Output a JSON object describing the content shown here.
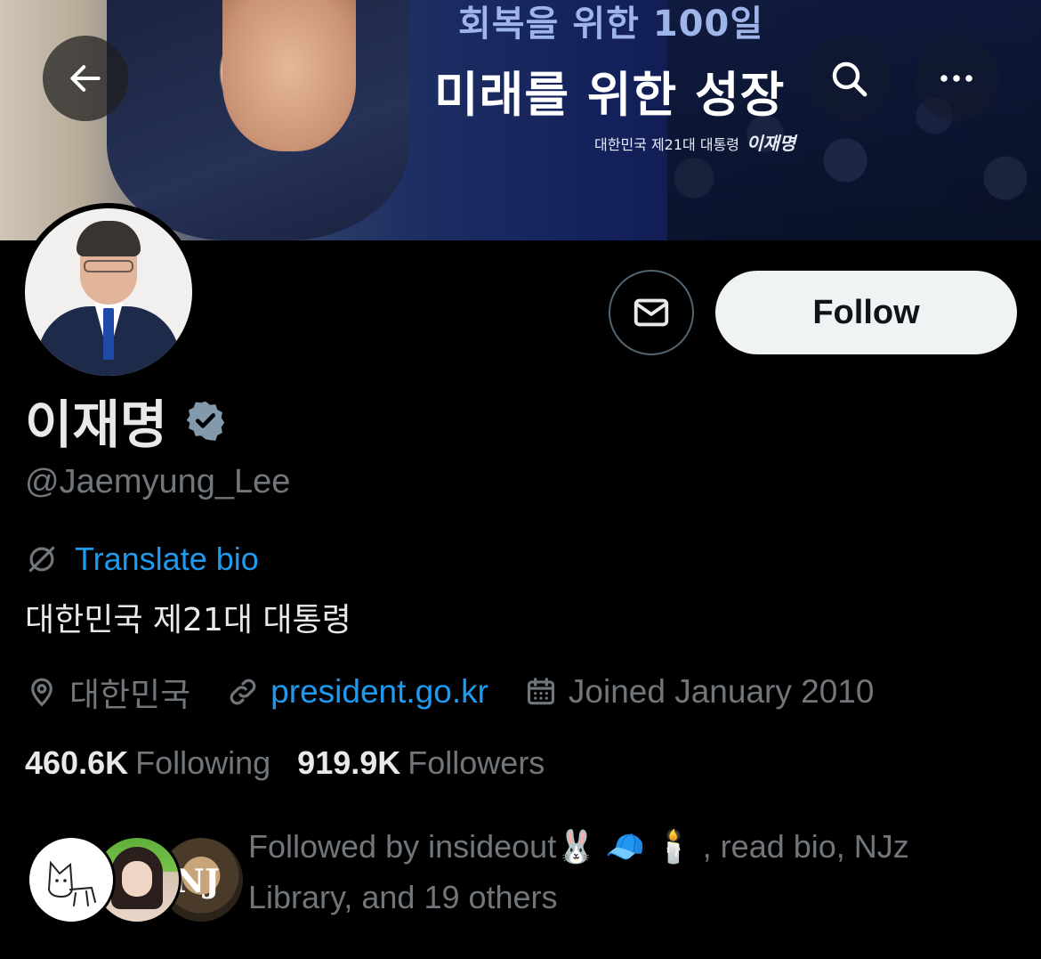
{
  "banner": {
    "headline_top": "회복을 위한 100일",
    "headline_main": "미래를 위한 성장",
    "subline": "대한민국 제21대 대통령",
    "signature": "이재명"
  },
  "toolbar": {
    "back_icon": "arrow-left-icon",
    "search_icon": "search-icon",
    "more_icon": "more-horizontal-icon"
  },
  "actions": {
    "message_icon": "envelope-icon",
    "follow_label": "Follow"
  },
  "profile": {
    "name": "이재명",
    "verified_badge": "verified-badge-icon",
    "handle": "@Jaemyung_Lee",
    "translate_label": "Translate bio",
    "bio": "대한민국 제21대 대통령",
    "location": "대한민국",
    "website": "president.go.kr",
    "joined": "Joined January 2010"
  },
  "stats": {
    "following_count": "460.6K",
    "following_label": "Following",
    "followers_count": "919.9K",
    "followers_label": "Followers"
  },
  "followed_by": {
    "text": "Followed by insideout🐰 🧢 🕯️ , read bio, NJz Library, and 19 others"
  },
  "colors": {
    "background": "#000000",
    "primary_text": "#e7e9ea",
    "secondary_text": "#71767b",
    "link": "#1d9bf0",
    "follow_button_bg": "#eff3f4"
  }
}
